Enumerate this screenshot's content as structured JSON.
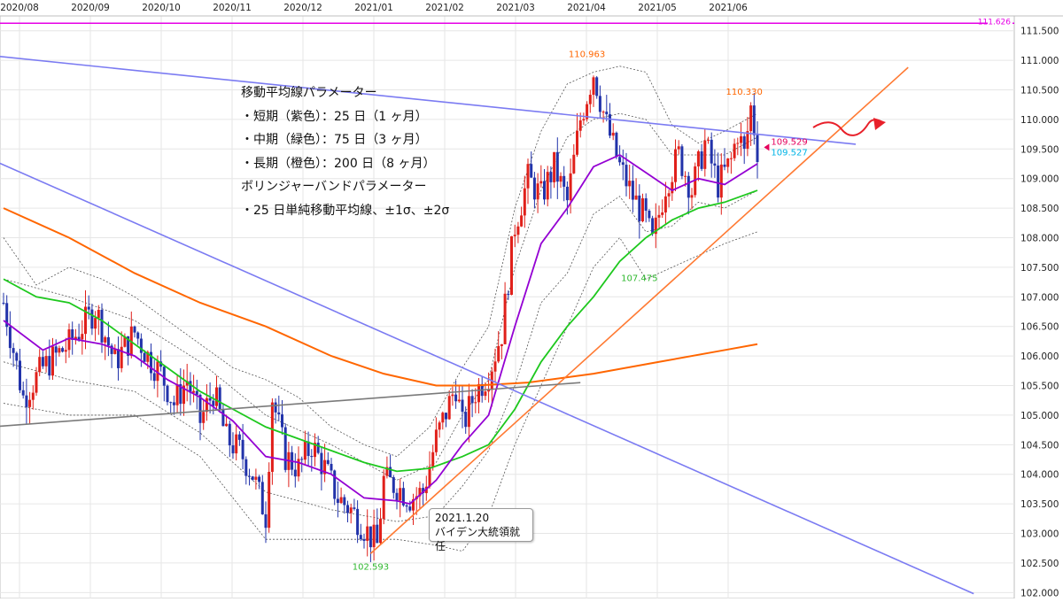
{
  "chart_data": {
    "type": "candlestick",
    "x_labels": [
      "2020/08",
      "2020/09",
      "2020/10",
      "2020/11",
      "2020/12",
      "2021/01",
      "2021/02",
      "2021/03",
      "2021/04",
      "2021/05",
      "2021/06"
    ],
    "y_ticks": [
      111.5,
      111.0,
      110.5,
      110.0,
      109.5,
      109.0,
      108.5,
      108.0,
      107.5,
      107.0,
      106.5,
      106.0,
      105.5,
      105.0,
      104.5,
      104.0,
      103.5,
      103.0,
      102.5,
      102.0
    ],
    "ylim": [
      101.9,
      111.75
    ],
    "grid": true,
    "price_path": [
      {
        "t": 0,
        "v": 106.9
      },
      {
        "t": 3,
        "v": 105.3
      },
      {
        "t": 6,
        "v": 105.8
      },
      {
        "t": 10,
        "v": 106.2
      },
      {
        "t": 14,
        "v": 106.8
      },
      {
        "t": 17,
        "v": 105.9
      },
      {
        "t": 20,
        "v": 106.4
      },
      {
        "t": 22,
        "v": 106.0
      },
      {
        "t": 24,
        "v": 105.7
      },
      {
        "t": 26,
        "v": 105.2
      },
      {
        "t": 28,
        "v": 105.6
      },
      {
        "t": 30,
        "v": 104.9
      },
      {
        "t": 32,
        "v": 105.4
      },
      {
        "t": 34,
        "v": 104.6
      },
      {
        "t": 36,
        "v": 104.4
      },
      {
        "t": 38,
        "v": 104.0
      },
      {
        "t": 40,
        "v": 103.3
      },
      {
        "t": 41,
        "v": 105.3
      },
      {
        "t": 43,
        "v": 104.3
      },
      {
        "t": 45,
        "v": 104.1
      },
      {
        "t": 47,
        "v": 104.5
      },
      {
        "t": 49,
        "v": 104.1
      },
      {
        "t": 51,
        "v": 103.6
      },
      {
        "t": 53,
        "v": 103.4
      },
      {
        "t": 55,
        "v": 103.1
      },
      {
        "t": 57,
        "v": 102.8
      },
      {
        "t": 58,
        "v": 103.9
      },
      {
        "t": 60,
        "v": 103.8
      },
      {
        "t": 62,
        "v": 103.6
      },
      {
        "t": 64,
        "v": 103.7
      },
      {
        "t": 66,
        "v": 104.6
      },
      {
        "t": 68,
        "v": 105.2
      },
      {
        "t": 69,
        "v": 105.5
      },
      {
        "t": 70,
        "v": 104.8
      },
      {
        "t": 72,
        "v": 105.4
      },
      {
        "t": 74,
        "v": 105.7
      },
      {
        "t": 76,
        "v": 106.4
      },
      {
        "t": 78,
        "v": 108.2
      },
      {
        "t": 80,
        "v": 109.0
      },
      {
        "t": 82,
        "v": 108.7
      },
      {
        "t": 84,
        "v": 109.2
      },
      {
        "t": 86,
        "v": 108.6
      },
      {
        "t": 88,
        "v": 110.0
      },
      {
        "t": 90,
        "v": 110.8
      },
      {
        "t": 92,
        "v": 109.9
      },
      {
        "t": 94,
        "v": 109.2
      },
      {
        "t": 96,
        "v": 108.7
      },
      {
        "t": 98,
        "v": 108.3
      },
      {
        "t": 99,
        "v": 107.9
      },
      {
        "t": 101,
        "v": 108.9
      },
      {
        "t": 103,
        "v": 109.4
      },
      {
        "t": 105,
        "v": 108.8
      },
      {
        "t": 107,
        "v": 109.6
      },
      {
        "t": 109,
        "v": 108.9
      },
      {
        "t": 111,
        "v": 109.3
      },
      {
        "t": 112,
        "v": 109.8
      },
      {
        "t": 113,
        "v": 109.4
      },
      {
        "t": 114,
        "v": 110.2
      },
      {
        "t": 115,
        "v": 109.5
      }
    ],
    "overlays": {
      "ma_short": {
        "name": "短期（紫色）：25日",
        "color": "#9400d3",
        "path": [
          [
            0,
            106.6
          ],
          [
            6,
            106.1
          ],
          [
            10,
            106.3
          ],
          [
            15,
            106.2
          ],
          [
            20,
            106.0
          ],
          [
            25,
            105.6
          ],
          [
            30,
            105.3
          ],
          [
            35,
            104.9
          ],
          [
            40,
            104.3
          ],
          [
            45,
            104.2
          ],
          [
            50,
            104.0
          ],
          [
            55,
            103.6
          ],
          [
            60,
            103.55
          ],
          [
            62,
            103.5
          ],
          [
            66,
            103.9
          ],
          [
            70,
            104.5
          ],
          [
            74,
            105.0
          ],
          [
            78,
            106.5
          ],
          [
            82,
            107.9
          ],
          [
            86,
            108.5
          ],
          [
            90,
            109.2
          ],
          [
            94,
            109.4
          ],
          [
            98,
            109.1
          ],
          [
            102,
            108.8
          ],
          [
            106,
            109.0
          ],
          [
            110,
            108.9
          ],
          [
            115,
            109.25
          ]
        ]
      },
      "ma_mid": {
        "name": "中期（緑色）：75日",
        "color": "#1ec81e",
        "path": [
          [
            0,
            107.3
          ],
          [
            5,
            107.0
          ],
          [
            10,
            106.9
          ],
          [
            15,
            106.6
          ],
          [
            20,
            106.2
          ],
          [
            25,
            105.8
          ],
          [
            30,
            105.4
          ],
          [
            35,
            105.1
          ],
          [
            40,
            104.8
          ],
          [
            45,
            104.6
          ],
          [
            50,
            104.4
          ],
          [
            55,
            104.2
          ],
          [
            60,
            104.05
          ],
          [
            65,
            104.1
          ],
          [
            70,
            104.3
          ],
          [
            74,
            104.5
          ],
          [
            78,
            105.1
          ],
          [
            82,
            105.9
          ],
          [
            86,
            106.5
          ],
          [
            90,
            107.0
          ],
          [
            94,
            107.6
          ],
          [
            98,
            108.0
          ],
          [
            102,
            108.3
          ],
          [
            106,
            108.5
          ],
          [
            110,
            108.6
          ],
          [
            115,
            108.8
          ]
        ]
      },
      "ma_long": {
        "name": "長期（橙色）：200日",
        "color": "#ff6600",
        "path": [
          [
            0,
            108.5
          ],
          [
            10,
            108.0
          ],
          [
            20,
            107.4
          ],
          [
            30,
            106.9
          ],
          [
            40,
            106.5
          ],
          [
            50,
            106.0
          ],
          [
            58,
            105.7
          ],
          [
            66,
            105.5
          ],
          [
            72,
            105.5
          ],
          [
            80,
            105.55
          ],
          [
            90,
            105.7
          ],
          [
            100,
            105.9
          ],
          [
            110,
            106.1
          ],
          [
            115,
            106.2
          ]
        ]
      },
      "bb_upper2": {
        "name": "+2σ",
        "path": [
          [
            0,
            108.0
          ],
          [
            5,
            107.2
          ],
          [
            10,
            107.5
          ],
          [
            15,
            107.3
          ],
          [
            20,
            107.0
          ],
          [
            25,
            106.6
          ],
          [
            30,
            106.2
          ],
          [
            35,
            105.8
          ],
          [
            40,
            105.6
          ],
          [
            45,
            105.3
          ],
          [
            50,
            104.8
          ],
          [
            55,
            104.5
          ],
          [
            60,
            104.3
          ],
          [
            65,
            104.8
          ],
          [
            70,
            105.8
          ],
          [
            74,
            106.5
          ],
          [
            78,
            108.5
          ],
          [
            82,
            109.8
          ],
          [
            86,
            110.6
          ],
          [
            90,
            110.8
          ],
          [
            94,
            110.9
          ],
          [
            98,
            110.8
          ],
          [
            102,
            109.9
          ],
          [
            106,
            109.6
          ],
          [
            110,
            109.8
          ],
          [
            115,
            110.1
          ]
        ]
      },
      "bb_upper1": {
        "name": "+1σ",
        "path": [
          [
            0,
            107.3
          ],
          [
            10,
            107.0
          ],
          [
            20,
            106.6
          ],
          [
            30,
            105.9
          ],
          [
            40,
            105.0
          ],
          [
            50,
            104.5
          ],
          [
            60,
            103.9
          ],
          [
            66,
            104.2
          ],
          [
            70,
            105.0
          ],
          [
            74,
            105.6
          ],
          [
            78,
            107.5
          ],
          [
            82,
            108.8
          ],
          [
            86,
            109.7
          ],
          [
            90,
            110.0
          ],
          [
            94,
            110.1
          ],
          [
            98,
            110.0
          ],
          [
            102,
            109.4
          ],
          [
            106,
            109.4
          ],
          [
            110,
            109.4
          ],
          [
            115,
            109.7
          ]
        ]
      },
      "bb_lower1": {
        "name": "-1σ",
        "path": [
          [
            0,
            105.9
          ],
          [
            10,
            105.6
          ],
          [
            20,
            105.4
          ],
          [
            30,
            104.7
          ],
          [
            40,
            103.7
          ],
          [
            50,
            103.4
          ],
          [
            60,
            103.2
          ],
          [
            66,
            103.3
          ],
          [
            70,
            103.8
          ],
          [
            74,
            104.4
          ],
          [
            78,
            105.5
          ],
          [
            82,
            106.9
          ],
          [
            86,
            107.4
          ],
          [
            90,
            108.4
          ],
          [
            94,
            108.7
          ],
          [
            98,
            108.1
          ],
          [
            102,
            108.2
          ],
          [
            106,
            108.6
          ],
          [
            110,
            108.5
          ],
          [
            115,
            108.8
          ]
        ]
      },
      "bb_lower2": {
        "name": "-2σ",
        "path": [
          [
            0,
            105.2
          ],
          [
            10,
            105.0
          ],
          [
            20,
            105.0
          ],
          [
            30,
            104.3
          ],
          [
            40,
            102.9
          ],
          [
            50,
            102.9
          ],
          [
            60,
            102.9
          ],
          [
            66,
            102.8
          ],
          [
            70,
            102.7
          ],
          [
            74,
            103.3
          ],
          [
            78,
            104.5
          ],
          [
            82,
            105.5
          ],
          [
            86,
            106.5
          ],
          [
            90,
            107.5
          ],
          [
            94,
            108.0
          ],
          [
            98,
            107.3
          ],
          [
            102,
            107.5
          ],
          [
            106,
            107.7
          ],
          [
            110,
            107.9
          ],
          [
            115,
            108.1
          ]
        ]
      }
    },
    "trendlines": [
      {
        "name": "upper-blue",
        "color": "#7b7bf2",
        "from": [
          -2,
          111.08
        ],
        "to": [
          130,
          109.58
        ]
      },
      {
        "name": "lower-blue",
        "color": "#7b7bf2",
        "from": [
          -2,
          109.33
        ],
        "to": [
          148,
          101.98
        ]
      },
      {
        "name": "orange-support",
        "color": "#ff7a33",
        "from": [
          56,
          102.66
        ],
        "to": [
          138,
          110.88
        ]
      },
      {
        "name": "gray",
        "color": "#7a7a7a",
        "from": [
          -2,
          104.8
        ],
        "to": [
          88,
          105.55
        ]
      }
    ],
    "hline": {
      "value": 111.626,
      "label": "111.626",
      "color": "#e600e6"
    },
    "markers": [
      {
        "label": "110.963",
        "t": 89,
        "v": 110.963,
        "color": "#ff6600"
      },
      {
        "label": "110.330",
        "t": 113,
        "v": 110.33,
        "color": "#ff6600"
      },
      {
        "label": "109.529",
        "t": 116,
        "v": 109.529,
        "color": "#e6005c"
      },
      {
        "label": "109.527",
        "t": 116,
        "v": 109.527,
        "color": "#00b4e6"
      },
      {
        "label": "107.475",
        "t": 97,
        "v": 107.475,
        "color": "#2fb82f"
      },
      {
        "label": "102.593",
        "t": 56,
        "v": 102.593,
        "color": "#2fb82f"
      }
    ]
  },
  "annotations": {
    "lines": [
      "移動平均線パラメーター",
      "・短期（紫色）：25 日（1 ヶ月）",
      "・中期（緑色）：75 日（3 ヶ月）",
      "・長期（橙色）：200 日（8 ヶ月）",
      "ボリンジャーバンドパラメーター",
      "・25 日単純移動平均線、±1σ、±2σ"
    ],
    "callout_date": "2021.1.20",
    "callout_text": "バイデン大統領就任"
  },
  "colors": {
    "up": "#e0201a",
    "down": "#2233aa",
    "grid": "#e6e6e6",
    "bb": "#555555",
    "arrow": "#e8202a"
  }
}
